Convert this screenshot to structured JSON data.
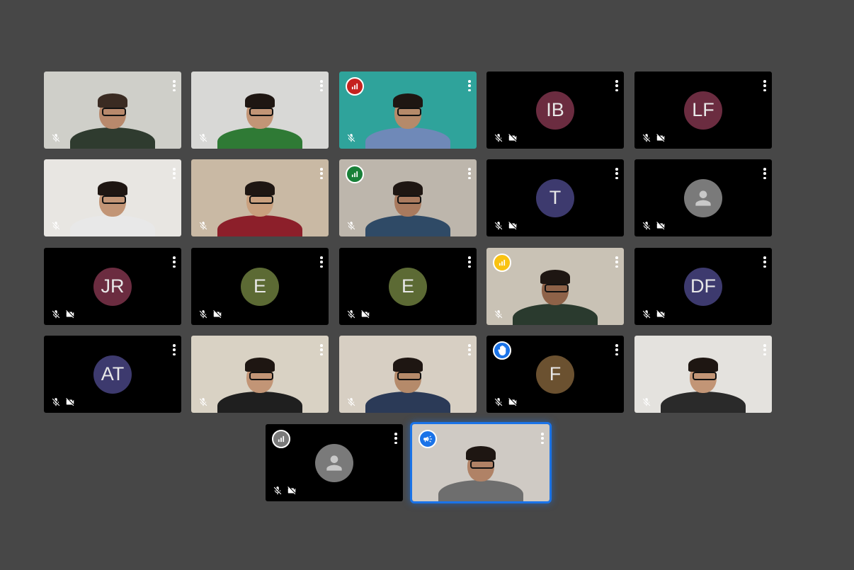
{
  "participants": [
    {
      "type": "video",
      "bg": "#cfcfc9",
      "shirt": "#2f3b2f",
      "skin": "#b8896c",
      "hair": "#3a2b22",
      "badge": null
    },
    {
      "type": "video",
      "bg": "#d8d8d6",
      "shirt": "#2f7a35",
      "skin": "#c29576",
      "hair": "#1e1612",
      "badge": null
    },
    {
      "type": "video",
      "bg": "#2fa39b",
      "shirt": "#6f89b8",
      "skin": "#b58a6a",
      "hair": "#1e1612",
      "badge": "speaking-red"
    },
    {
      "type": "initials",
      "initials": "IB",
      "color": "#6b2c40",
      "badge": null
    },
    {
      "type": "initials",
      "initials": "LF",
      "color": "#6b2c40",
      "badge": null
    },
    {
      "type": "video",
      "bg": "#e8e6e2",
      "shirt": "#e8e8e8",
      "skin": "#c29576",
      "hair": "#1e1612",
      "badge": null
    },
    {
      "type": "video",
      "bg": "#c9b9a4",
      "shirt": "#8c1f2a",
      "skin": "#c9a07e",
      "hair": "#1e1612",
      "badge": null
    },
    {
      "type": "video",
      "bg": "#bdb6ac",
      "shirt": "#2f4a66",
      "skin": "#a97a5e",
      "hair": "#1e1612",
      "badge": "speaking-green"
    },
    {
      "type": "initials",
      "initials": "T",
      "color": "#3d3a6e",
      "badge": null
    },
    {
      "type": "generic",
      "badge": null
    },
    {
      "type": "initials",
      "initials": "JR",
      "color": "#6b2c40",
      "badge": null
    },
    {
      "type": "initials",
      "initials": "E",
      "color": "#5c6a34",
      "badge": null
    },
    {
      "type": "initials",
      "initials": "E",
      "color": "#5c6a34",
      "badge": null
    },
    {
      "type": "video",
      "bg": "#c9c2b5",
      "shirt": "#2a3a2e",
      "skin": "#8e6248",
      "hair": "#1e1612",
      "badge": "speaking-yellow"
    },
    {
      "type": "initials",
      "initials": "DF",
      "color": "#3d3a6e",
      "badge": null
    },
    {
      "type": "initials",
      "initials": "AT",
      "color": "#3d3a6e",
      "badge": null
    },
    {
      "type": "video",
      "bg": "#d9d2c4",
      "shirt": "#1f1f1f",
      "skin": "#c29576",
      "hair": "#1e1612",
      "badge": null
    },
    {
      "type": "video",
      "bg": "#d7cfc3",
      "shirt": "#2b3a57",
      "skin": "#b58a6a",
      "hair": "#1e1612",
      "badge": null
    },
    {
      "type": "initials",
      "initials": "F",
      "color": "#6b5130",
      "badge": "raised-hand"
    },
    {
      "type": "video",
      "bg": "#e4e2de",
      "shirt": "#2a2a2a",
      "skin": "#c29576",
      "hair": "#1e1612",
      "badge": null
    },
    {
      "type": "generic",
      "badge": "speaking-gray"
    },
    {
      "type": "video",
      "bg": "#cfcac4",
      "shirt": "#6e6e6e",
      "skin": "#b08266",
      "hair": "#1e1612",
      "badge": "presenting",
      "active": true
    }
  ],
  "badge_colors": {
    "speaking-red": "#c5221f",
    "speaking-green": "#188038",
    "speaking-yellow": "#f9c211",
    "speaking-gray": "#7a7a7a",
    "raised-hand": "#1a73e8",
    "presenting": "#1a73e8"
  }
}
